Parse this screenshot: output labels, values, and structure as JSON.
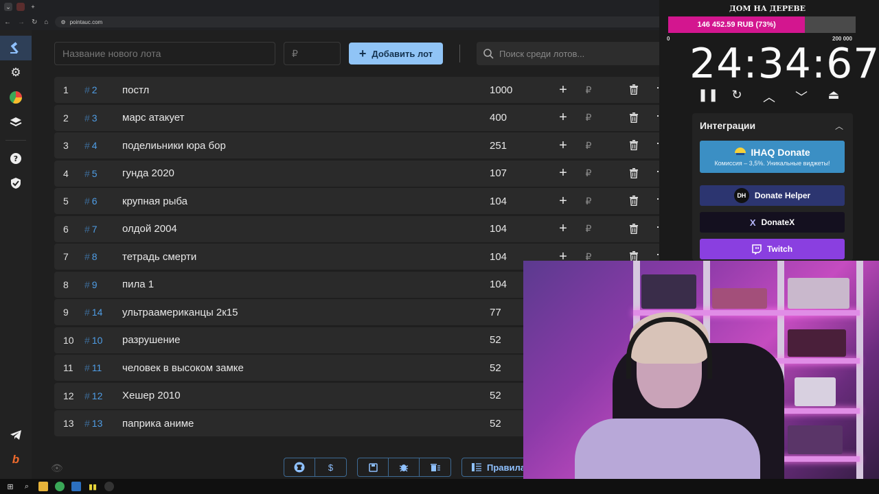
{
  "browser": {
    "url": "pointauc.com",
    "tab_icons": [
      "chevron-down-icon",
      "tab-favicon",
      "plus-icon"
    ],
    "window_controls": [
      "—",
      "▢",
      "✕"
    ]
  },
  "goal": {
    "title": "ДОМ НА ДЕРЕВЕ",
    "progress_text": "146 452.59 RUB (73%)",
    "progress_fraction": 0.73,
    "min_label": "0",
    "max_label": "200 000",
    "fill_color": "#d3168f"
  },
  "form": {
    "name_placeholder": "Название нового лота",
    "amount_placeholder": "₽",
    "add_button": "Добавить лот",
    "search_placeholder": "Поиск среди лотов..."
  },
  "lots": [
    {
      "index": "1",
      "fast_id": "2",
      "name": "постл",
      "amount": "1000"
    },
    {
      "index": "2",
      "fast_id": "3",
      "name": "марс атакует",
      "amount": "400"
    },
    {
      "index": "3",
      "fast_id": "4",
      "name": "поделиьники юра бор",
      "amount": "251"
    },
    {
      "index": "4",
      "fast_id": "5",
      "name": "гунда 2020",
      "amount": "107"
    },
    {
      "index": "5",
      "fast_id": "6",
      "name": "крупная рыба",
      "amount": "104"
    },
    {
      "index": "6",
      "fast_id": "7",
      "name": "олдой 2004",
      "amount": "104"
    },
    {
      "index": "7",
      "fast_id": "8",
      "name": "тетрадь смерти",
      "amount": "104"
    },
    {
      "index": "8",
      "fast_id": "9",
      "name": "пила 1",
      "amount": "104"
    },
    {
      "index": "9",
      "fast_id": "14",
      "name": "ультраамериканцы 2к15",
      "amount": "77"
    },
    {
      "index": "10",
      "fast_id": "10",
      "name": "разрушение",
      "amount": "52"
    },
    {
      "index": "11",
      "fast_id": "11",
      "name": "человек в высоком замке",
      "amount": "52"
    },
    {
      "index": "12",
      "fast_id": "12",
      "name": "Хешер 2010",
      "amount": "52"
    },
    {
      "index": "13",
      "fast_id": "13",
      "name": "паприка аниме",
      "amount": "52"
    }
  ],
  "lot_row": {
    "hash": "#",
    "plus": "+",
    "currency": "₽",
    "more": "⋯"
  },
  "timer": {
    "display": "24:34:67"
  },
  "integrations": {
    "title": "Интеграции",
    "ihaq": {
      "name": "IHAQ Donate",
      "subtitle": "Комиссия – 3,5%. Уникальные виджеты!"
    },
    "donate_helper": {
      "name": "Donate Helper",
      "logo": "DH"
    },
    "donatex": {
      "name": "DonateX",
      "logo": "X"
    },
    "twitch": {
      "name": "Twitch"
    }
  },
  "bottom": {
    "rules_label": "Правила"
  }
}
